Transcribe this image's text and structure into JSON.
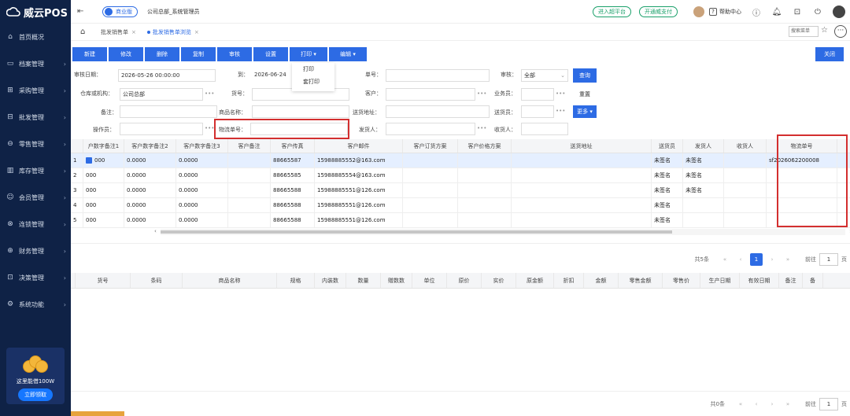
{
  "brand": {
    "name": "威云POS"
  },
  "sidebar": {
    "items": [
      {
        "label": "首页概况",
        "icon": "home-icon"
      },
      {
        "label": "档案管理",
        "icon": "folder-icon"
      },
      {
        "label": "采购管理",
        "icon": "cart-icon"
      },
      {
        "label": "批发管理",
        "icon": "wholesale-icon"
      },
      {
        "label": "零售管理",
        "icon": "retail-icon"
      },
      {
        "label": "库存管理",
        "icon": "inventory-icon"
      },
      {
        "label": "会员管理",
        "icon": "member-icon"
      },
      {
        "label": "连锁管理",
        "icon": "chain-icon"
      },
      {
        "label": "财务管理",
        "icon": "finance-icon"
      },
      {
        "label": "决策管理",
        "icon": "decision-icon"
      },
      {
        "label": "系统功能",
        "icon": "gear-icon"
      }
    ],
    "promo": {
      "text": "这里能借100W",
      "button": "立即领取"
    }
  },
  "header": {
    "edition": "商业版",
    "company": "公司总部_系统管理员",
    "links": [
      "进入超平台",
      "开通威支付"
    ],
    "help": "帮助中心"
  },
  "tabs": [
    {
      "label": "批发销售单",
      "active": false
    },
    {
      "label": "批发销售单浏览",
      "active": true
    }
  ],
  "menu_search_placeholder": "搜索菜单",
  "toolbar": {
    "buttons": [
      "新建",
      "修改",
      "删除",
      "复制",
      "审核",
      "设置",
      "打印 ▾",
      "编辑 ▾"
    ],
    "close": "关闭"
  },
  "print_menu": {
    "items": [
      "打印",
      "套打印"
    ]
  },
  "filters": {
    "audit_date_label": "审核日期：",
    "date_from": "2026-05-26 00:00:00",
    "to_label": "到：",
    "date_to": "2026-06-24",
    "order_no_label": "单号：",
    "audit_label": "审核：",
    "audit_value": "全部",
    "query_button": "查询",
    "warehouse_label": "仓库或机构：",
    "warehouse_value": "公司总部",
    "goods_no_label": "货号：",
    "customer_label": "客户：",
    "salesman_label": "业务员：",
    "reset_button": "重置",
    "remark_label": "备注：",
    "product_name_label": "商品名称：",
    "ship_address_label": "送货地址：",
    "delivery_person_label": "送货员：",
    "more_button": "更多 ▾",
    "operator_label": "操作员：",
    "tracking_no_label": "物流单号：",
    "shipper_label": "发货人：",
    "receiver_label": "收货人："
  },
  "table": {
    "headers": [
      "",
      "户数字备注1",
      "客户数字备注2",
      "客户数字备注3",
      "客户备注",
      "客户传真",
      "客户邮件",
      "客户订货方案",
      "客户价格方案",
      "送货地址",
      "送货员",
      "发货人",
      "收货人",
      "物流单号"
    ],
    "rows": [
      {
        "no": "1",
        "c1": "000",
        "c2": "0.0000",
        "c3": "0.0000",
        "fax": "88665587",
        "email": "15988885552@163.com",
        "deliver": "未签名",
        "shipper": "未签名",
        "tracking": "sf2026062200008"
      },
      {
        "no": "2",
        "c1": "000",
        "c2": "0.0000",
        "c3": "0.0000",
        "fax": "88665585",
        "email": "15988885554@163.com",
        "deliver": "未签名",
        "shipper": "未签名",
        "tracking": ""
      },
      {
        "no": "3",
        "c1": "000",
        "c2": "0.0000",
        "c3": "0.0000",
        "fax": "88665588",
        "email": "15988885551@126.com",
        "deliver": "未签名",
        "shipper": "未签名",
        "tracking": ""
      },
      {
        "no": "4",
        "c1": "000",
        "c2": "0.0000",
        "c3": "0.0000",
        "fax": "88665588",
        "email": "15988885551@126.com",
        "deliver": "未签名",
        "shipper": "",
        "tracking": ""
      },
      {
        "no": "5",
        "c1": "000",
        "c2": "0.0000",
        "c3": "0.0000",
        "fax": "88665588",
        "email": "15988885551@126.com",
        "deliver": "未签名",
        "shipper": "",
        "tracking": ""
      }
    ]
  },
  "pager": {
    "total": "共5条",
    "page": "1",
    "goto_label": "前往",
    "goto_value": "1",
    "page_unit": "页"
  },
  "detail_headers": [
    "货号",
    "条码",
    "商品名称",
    "规格",
    "内装数",
    "数量",
    "赠数数",
    "单位",
    "原价",
    "实价",
    "原金额",
    "折扣",
    "金额",
    "零售金额",
    "零售价",
    "生产日期",
    "有效日期",
    "备注",
    "备"
  ],
  "detail_pager": {
    "total": "共0条",
    "goto_label": "前往",
    "goto_value": "1",
    "page_unit": "页"
  }
}
